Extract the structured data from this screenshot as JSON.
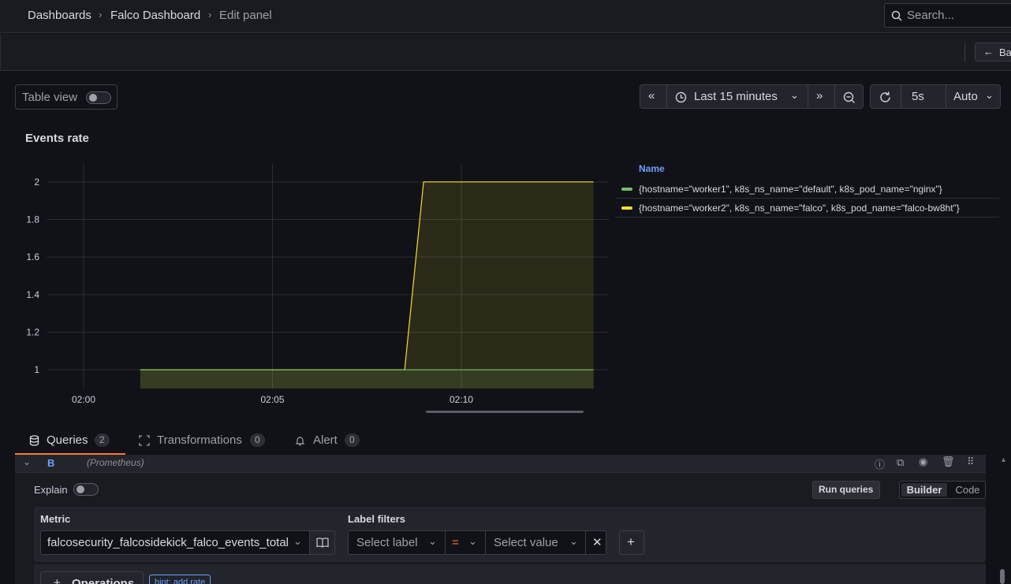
{
  "breadcrumbs": [
    "Dashboards",
    "Falco Dashboard",
    "Edit panel"
  ],
  "search": {
    "placeholder": "Search..."
  },
  "back_button": "Ba",
  "toolbar": {
    "table_view_label": "Table view",
    "time_range": "Last 15 minutes",
    "refresh_interval": "5s",
    "auto_label": "Auto"
  },
  "panel": {
    "title": "Events rate"
  },
  "chart_data": {
    "type": "line",
    "title": "Events rate",
    "x_ticks": [
      "02:00",
      "02:05",
      "02:10"
    ],
    "y_ticks": [
      1,
      1.2,
      1.4,
      1.6,
      1.8,
      2
    ],
    "ylim": [
      0.9,
      2.1
    ],
    "legend_header": "Name",
    "series": [
      {
        "name": "{hostname=\"worker1\", k8s_ns_name=\"default\", k8s_pod_name=\"nginx\"}",
        "color": "#73bf69",
        "points": [
          [
            "02:01.5",
            1
          ],
          [
            "02:13.5",
            1
          ]
        ]
      },
      {
        "name": "{hostname=\"worker2\", k8s_ns_name=\"falco\", k8s_pod_name=\"falco-bw8ht\"}",
        "color": "#fade2a",
        "points": [
          [
            "02:01.5",
            1
          ],
          [
            "02:08.5",
            1
          ],
          [
            "02:09",
            2
          ],
          [
            "02:13.5",
            2
          ]
        ]
      }
    ]
  },
  "tabs": [
    {
      "label": "Queries",
      "count": "2"
    },
    {
      "label": "Transformations",
      "count": "0"
    },
    {
      "label": "Alert",
      "count": "0"
    }
  ],
  "query": {
    "ref": "B",
    "datasource": "(Prometheus)",
    "explain_label": "Explain",
    "run_queries": "Run queries",
    "mode_builder": "Builder",
    "mode_code": "Code",
    "metric_label": "Metric",
    "metric_value": "falcosecurity_falcosidekick_falco_events_total",
    "label_filters_label": "Label filters",
    "select_label": "Select label",
    "operator": "=",
    "select_value": "Select value",
    "operations_label": "Operations",
    "hint": "hint: add rate"
  }
}
